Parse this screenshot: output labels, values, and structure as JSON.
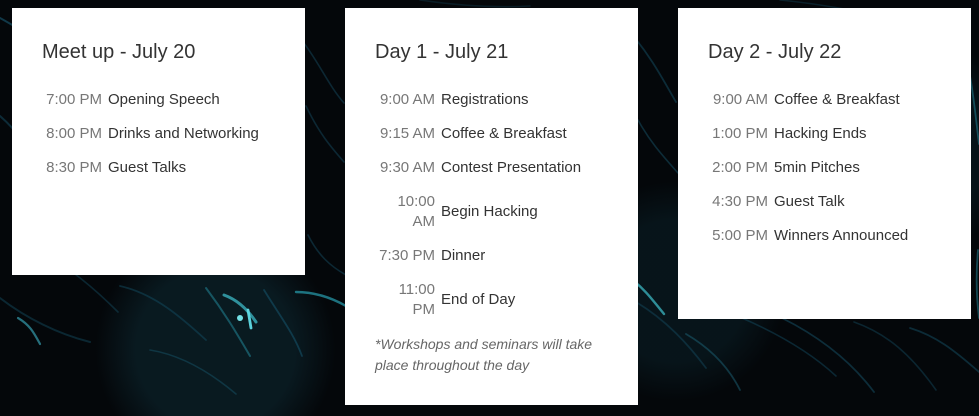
{
  "cards": [
    {
      "title": "Meet up - July 20",
      "items": [
        {
          "time": "7:00 PM",
          "event": "Opening Speech"
        },
        {
          "time": "8:00 PM",
          "event": "Drinks and Networking"
        },
        {
          "time": "8:30 PM",
          "event": "Guest Talks"
        }
      ]
    },
    {
      "title": "Day 1 - July 21",
      "items": [
        {
          "time": "9:00 AM",
          "event": "Registrations"
        },
        {
          "time": "9:15 AM",
          "event": "Coffee & Breakfast"
        },
        {
          "time": "9:30 AM",
          "event": "Contest Presentation"
        },
        {
          "time": "10:00 AM",
          "event": "Begin Hacking"
        },
        {
          "time": "7:30 PM",
          "event": "Dinner"
        },
        {
          "time": "11:00 PM",
          "event": "End of Day"
        }
      ],
      "note": "*Workshops and seminars will take place throughout the day"
    },
    {
      "title": "Day 2 - July 22",
      "items": [
        {
          "time": "9:00 AM",
          "event": "Coffee & Breakfast"
        },
        {
          "time": "1:00 PM",
          "event": "Hacking Ends"
        },
        {
          "time": "2:00 PM",
          "event": "5min Pitches"
        },
        {
          "time": "4:30 PM",
          "event": "Guest Talk"
        },
        {
          "time": "5:00 PM",
          "event": "Winners Announced"
        }
      ]
    }
  ]
}
